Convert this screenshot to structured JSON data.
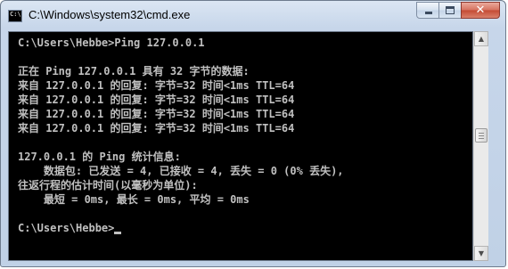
{
  "window": {
    "title": "C:\\Windows\\system32\\cmd.exe",
    "icon_label": "C:\\",
    "close_glyph": "✕"
  },
  "console": {
    "lines": [
      "C:\\Users\\Hebbe>Ping 127.0.0.1",
      "",
      "正在 Ping 127.0.0.1 具有 32 字节的数据:",
      "来自 127.0.0.1 的回复: 字节=32 时间<1ms TTL=64",
      "来自 127.0.0.1 的回复: 字节=32 时间<1ms TTL=64",
      "来自 127.0.0.1 的回复: 字节=32 时间<1ms TTL=64",
      "来自 127.0.0.1 的回复: 字节=32 时间<1ms TTL=64",
      "",
      "127.0.0.1 的 Ping 统计信息:",
      "    数据包: 已发送 = 4, 已接收 = 4, 丢失 = 0 (0% 丢失),",
      "往返行程的估计时间(以毫秒为单位):",
      "    最短 = 0ms, 最长 = 0ms, 平均 = 0ms",
      "",
      "C:\\Users\\Hebbe>"
    ],
    "text_color": "#c0c0c0",
    "background_color": "#000000"
  },
  "scrollbar": {
    "up_arrow": "▲",
    "down_arrow": "▼"
  }
}
